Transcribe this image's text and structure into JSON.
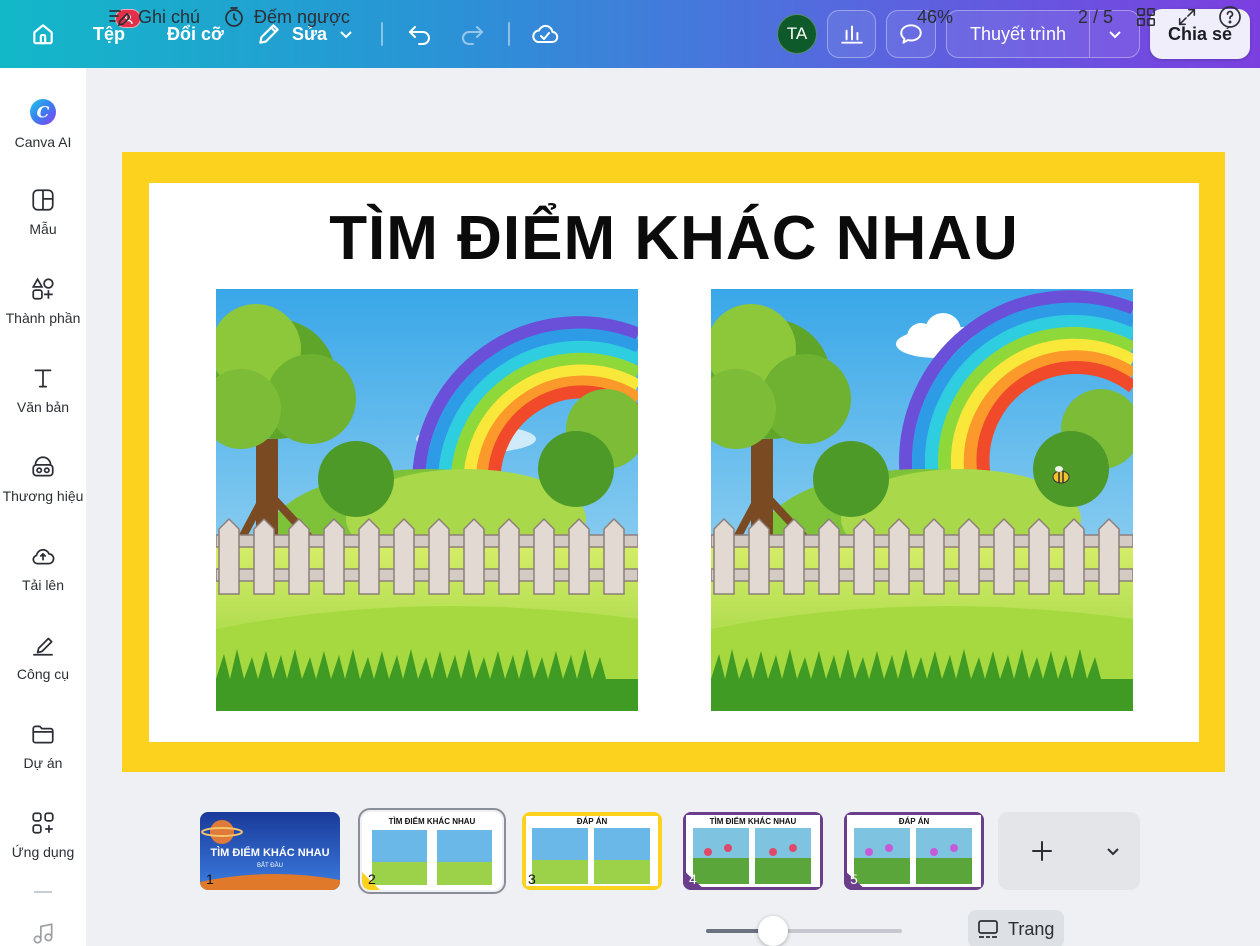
{
  "topbar": {
    "file_label": "Tệp",
    "resize_label": "Đổi cỡ",
    "edit_label": "Sửa",
    "avatar_initials": "TA",
    "present_label": "Thuyết trình",
    "share_label": "Chia sẻ",
    "gradient_colors": [
      "#13b8c8",
      "#2a93d6",
      "#5a64df",
      "#7b3fe0"
    ],
    "badge_color": "#e2304a"
  },
  "sidebar": {
    "items": [
      {
        "label": "Canva AI",
        "icon": "canva-ai-icon"
      },
      {
        "label": "Mẫu",
        "icon": "templates-icon"
      },
      {
        "label": "Thành phần",
        "icon": "elements-icon"
      },
      {
        "label": "Văn bản",
        "icon": "text-icon"
      },
      {
        "label": "Thương hiệu",
        "icon": "brand-icon"
      },
      {
        "label": "Tải lên",
        "icon": "upload-icon"
      },
      {
        "label": "Công cụ",
        "icon": "tools-icon"
      },
      {
        "label": "Dự án",
        "icon": "projects-icon"
      },
      {
        "label": "Ứng dụng",
        "icon": "apps-icon"
      }
    ]
  },
  "slide": {
    "title": "TÌM ĐIỂM KHÁC NHAU",
    "frame_color": "#fcd21f"
  },
  "pages": [
    {
      "number": "1",
      "title": "TÌM ĐIỂM KHÁC NHAU",
      "subtitle": "BẮT ĐẦU"
    },
    {
      "number": "2",
      "title": "TÌM ĐIỂM KHÁC NHAU"
    },
    {
      "number": "3",
      "title": "ĐÁP ÁN"
    },
    {
      "number": "4",
      "title": "TÌM ĐIỂM KHÁC NHAU"
    },
    {
      "number": "5",
      "title": "ĐÁP ÁN"
    }
  ],
  "bottombar": {
    "notes_label": "Ghi chú",
    "timer_label": "Đếm ngược",
    "zoom_value": 46,
    "zoom_label": "46%",
    "pages_label": "Trang",
    "page_counter": "2 / 5"
  }
}
